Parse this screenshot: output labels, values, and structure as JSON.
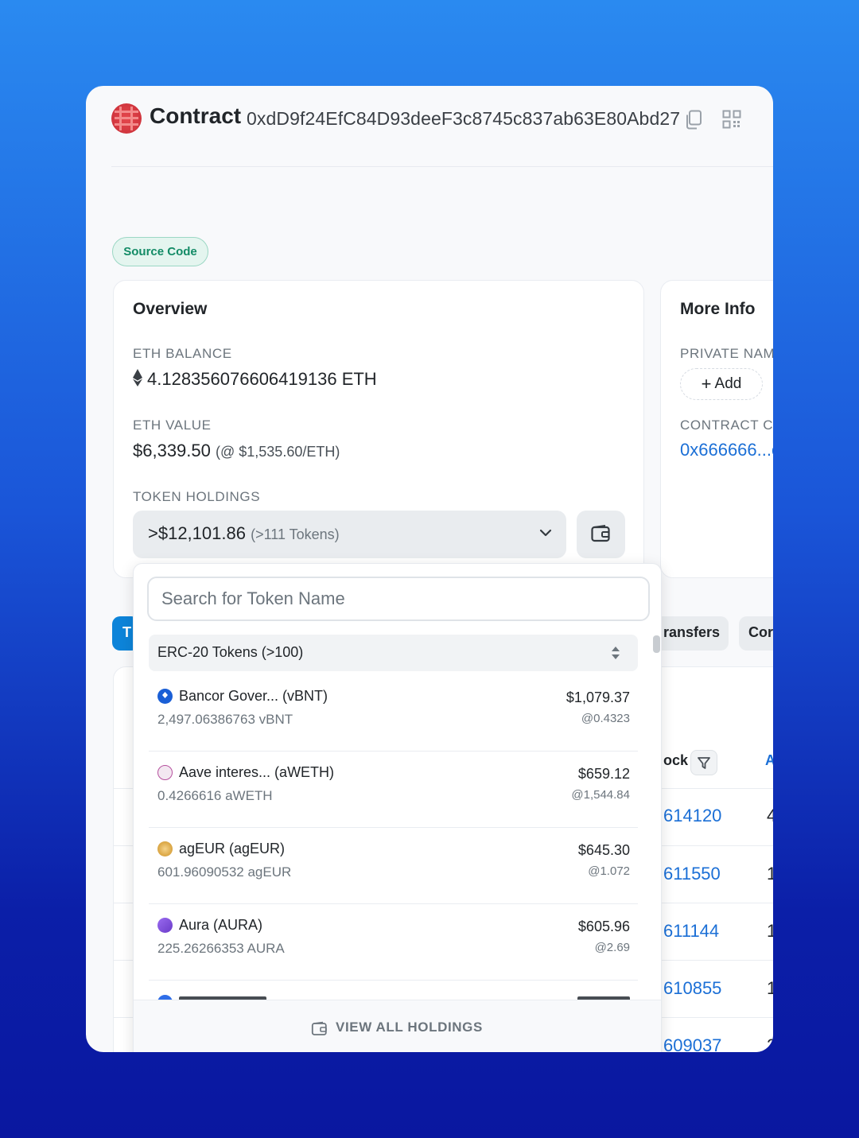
{
  "header": {
    "title": "Contract",
    "address": "0xdD9f24EfC84D93deeF3c8745c837ab63E80Abd27"
  },
  "badge": "Source Code",
  "overview": {
    "title": "Overview",
    "eth_balance_label": "ETH BALANCE",
    "eth_balance": "4.128356076606419136 ETH",
    "eth_value_label": "ETH VALUE",
    "eth_value": "$6,339.50",
    "eth_value_rate": "(@ $1,535.60/ETH)",
    "token_holdings_label": "TOKEN HOLDINGS",
    "token_holdings_value": ">$12,101.86",
    "token_holdings_count": "(>111 Tokens)"
  },
  "more_info": {
    "title": "More Info",
    "private_name_label": "PRIVATE NAM",
    "add_label": "Add",
    "contract_creator_label": "CONTRACT C",
    "contract_creator_value": "0x666666...c"
  },
  "tabs": {
    "active_label": "T",
    "transfers_label": "ransfers",
    "contract_label": "Cor"
  },
  "table": {
    "block_header": "ock",
    "next_header": "A",
    "rows": [
      {
        "block": "614120",
        "next": "4"
      },
      {
        "block": "611550",
        "next": "1"
      },
      {
        "block": "611144",
        "next": "1"
      },
      {
        "block": "610855",
        "next": "1"
      },
      {
        "block": "609037",
        "next": "2"
      }
    ]
  },
  "dropdown": {
    "search_placeholder": "Search for Token Name",
    "section_title": "ERC-20 Tokens (>100)",
    "tokens": [
      {
        "name": "Bancor Gover... (vBNT)",
        "quantity": "2,497.06386763 vBNT",
        "usd": "$1,079.37",
        "rate": "@0.4323",
        "icon": "bancor-icon",
        "color": "#1a5fd6"
      },
      {
        "name": "Aave interes... (aWETH)",
        "quantity": "0.4266616 aWETH",
        "usd": "$659.12",
        "rate": "@1,544.84",
        "icon": "aave-icon",
        "color": "#b6509e"
      },
      {
        "name": "agEUR (agEUR)",
        "quantity": "601.96090532 agEUR",
        "usd": "$645.30",
        "rate": "@1.072",
        "icon": "ageur-icon",
        "color": "#d9a441"
      },
      {
        "name": "Aura (AURA)",
        "quantity": "225.26266353 AURA",
        "usd": "$605.96",
        "rate": "@2.69",
        "icon": "aura-icon",
        "color": "#7b4bd6"
      }
    ],
    "view_all_label": "VIEW ALL HOLDINGS"
  }
}
